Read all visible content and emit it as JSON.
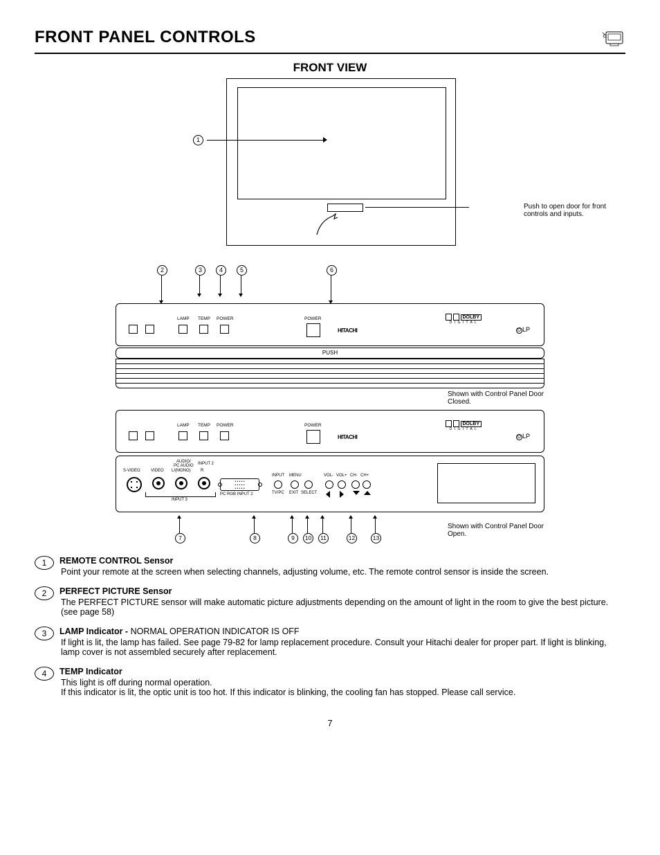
{
  "header": {
    "title": "FRONT PANEL CONTROLS"
  },
  "subtitle": "FRONT VIEW",
  "pushNote": "Push to open door for front controls and inputs.",
  "captionClosed": "Shown with Control Panel Door Closed.",
  "captionOpen": "Shown with Control Panel Door Open.",
  "labels": {
    "lamp": "LAMP",
    "temp": "TEMP",
    "power": "POWER",
    "powerBtn": "POWER",
    "push": "PUSH",
    "hitachi": "HITACHI",
    "dolby": "DOLBY",
    "digital": "D I G I T A L",
    "dlp": "DLP",
    "svideo": "S-VIDEO",
    "video": "VIDEO",
    "audioPc": "AUDIO/\nPC AUDIO",
    "lmono": "L/(MONO)",
    "r": "R",
    "input2": "INPUT 2",
    "input3": "INPUT 3",
    "pcRgb": "PC  RGB INPUT 2",
    "input": "INPUT",
    "menu": "MENU",
    "tvpc": "TV/PC",
    "exit": "EXIT",
    "select": "SELECT",
    "volMinus": "VOL-",
    "volPlus": "VOL+",
    "chMinus": "CH-",
    "chPlus": "CH+"
  },
  "descriptions": [
    {
      "num": "1",
      "title": "REMOTE CONTROL Sensor",
      "extra": "",
      "text": "Point your remote at the screen when selecting channels, adjusting volume, etc. The remote control sensor is inside the screen."
    },
    {
      "num": "2",
      "title": "PERFECT PICTURE Sensor",
      "extra": "",
      "text": "The PERFECT PICTURE sensor will make automatic picture adjustments depending on the amount of light in the room to give the best picture. (see page 58)"
    },
    {
      "num": "3",
      "title": "LAMP Indicator - ",
      "extra": "NORMAL OPERATION INDICATOR IS OFF",
      "text": "If light is lit, the lamp has failed.  See page 79-82 for lamp replacement procedure.  Consult your Hitachi dealer for proper part.  If light is blinking, lamp cover is not assembled securely after replacement."
    },
    {
      "num": "4",
      "title": "TEMP Indicator",
      "extra": "",
      "text": "This light is off during normal operation.\nIf this indicator is lit, the optic unit is too hot.  If this indicator is blinking, the cooling fan has stopped.  Please call service."
    }
  ],
  "pageNumber": "7"
}
